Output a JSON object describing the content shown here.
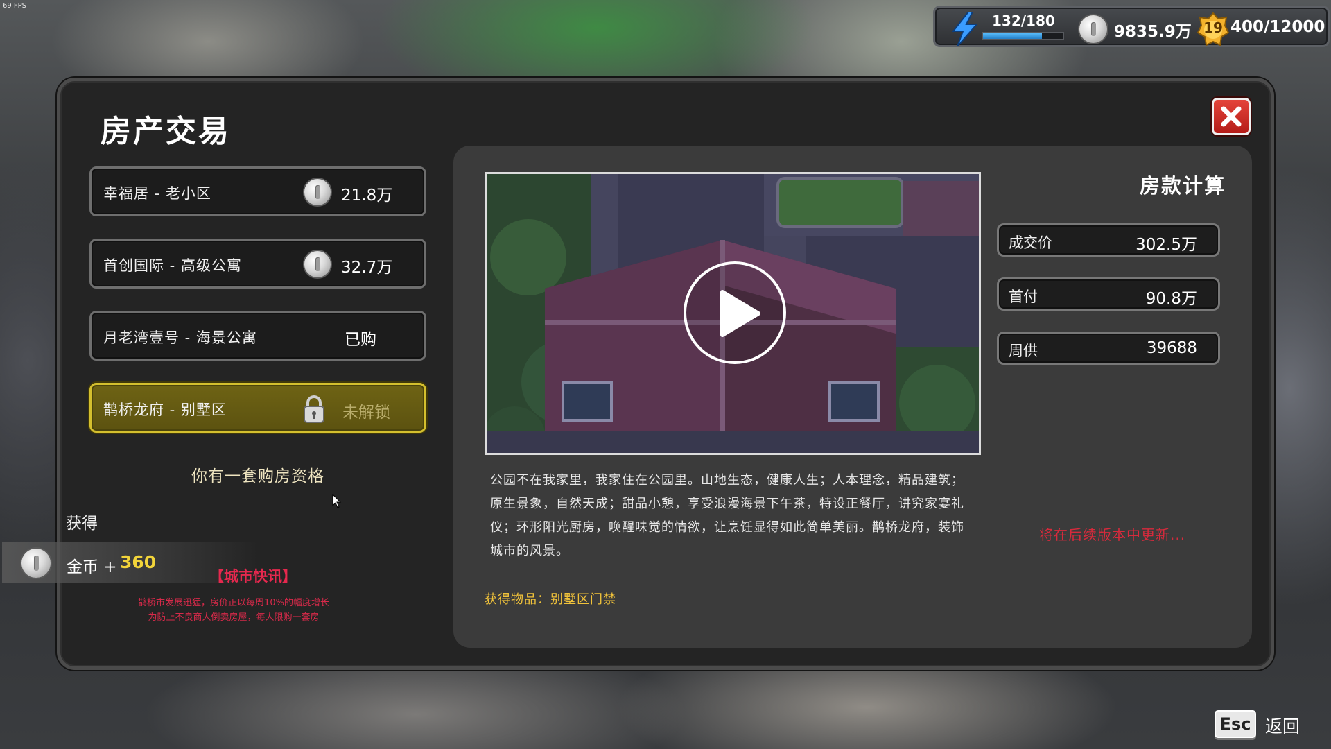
{
  "fps": "69 FPS",
  "hud": {
    "energy": "132/180",
    "energy_ratio": 0.733,
    "money": "9835.9万",
    "level": "19",
    "exp": "400/12000"
  },
  "panel": {
    "title": "房产交易",
    "properties": [
      {
        "name": "幸福居 - 老小区",
        "price": "21.8万",
        "state": "price"
      },
      {
        "name": "首创国际 - 高级公寓",
        "price": "32.7万",
        "state": "price"
      },
      {
        "name": "月老湾壹号 - 海景公寓",
        "status": "已购",
        "state": "bought"
      },
      {
        "name": "鹊桥龙府 - 别墅区",
        "status": "未解锁",
        "state": "locked"
      }
    ],
    "qualification": "你有一套购房资格",
    "gain_label": "获得",
    "reward": {
      "label": "金币 +",
      "value": "360"
    },
    "news": {
      "title": "【城市快讯】",
      "line1": "鹊桥市发展迅猛，房价正以每周10%的幅度增长",
      "line2": "为防止不良商人倒卖房屋，每人限购一套房"
    },
    "description": "公园不在我家里，我家住在公园里。山地生态，健康人生；人本理念，精品建筑；原生景象，自然天成；甜品小憩，享受浪漫海景下午茶，特设正餐厅，讲究家宴礼仪；环形阳光厨房，唤醒味觉的情欲，让烹饪显得如此简单美丽。鹊桥龙府，装饰城市的风景。",
    "obtain_item": "获得物品：别墅区门禁",
    "calc": {
      "title": "房款计算",
      "rows": [
        {
          "label": "成交价",
          "value": "302.5万"
        },
        {
          "label": "首付",
          "value": "90.8万"
        },
        {
          "label": "周供",
          "value": "39688"
        }
      ]
    },
    "coming_soon": "将在后续版本中更新..."
  },
  "footer": {
    "esc": "Esc",
    "back": "返回"
  },
  "colors": {
    "accent_gold": "#f2d43a",
    "selected_bg": "#6e6314",
    "selected_border": "#d4bf2e",
    "news_red": "#e6284e",
    "close_red": "#d0302a"
  }
}
